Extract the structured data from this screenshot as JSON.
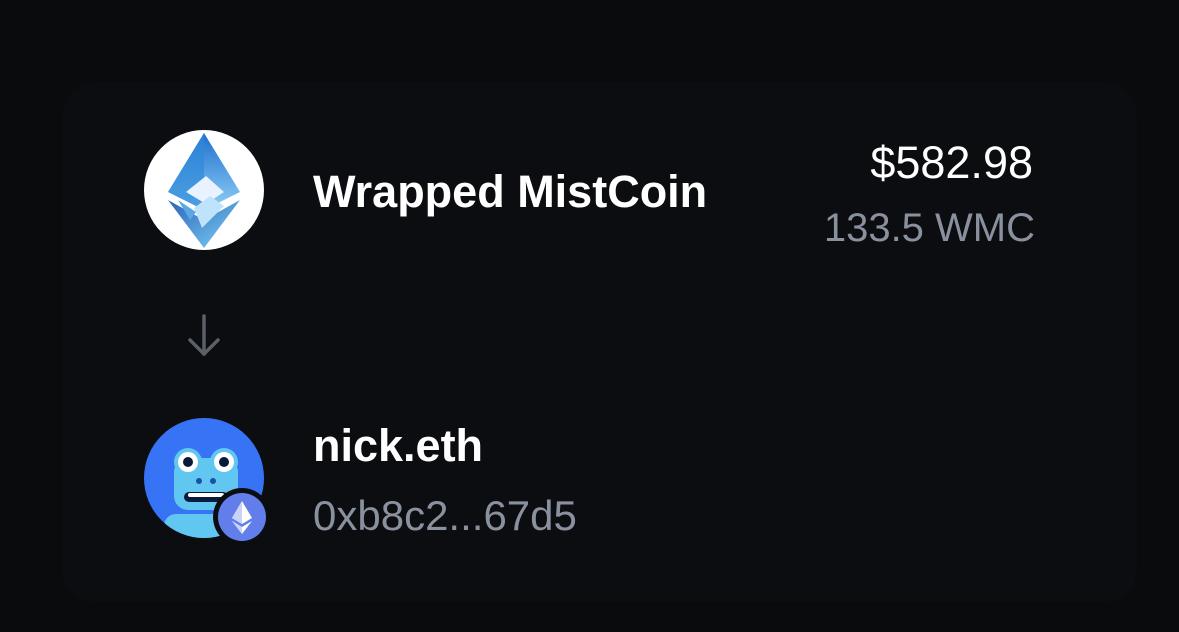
{
  "transfer": {
    "token": {
      "name": "Wrapped MistCoin",
      "fiat_amount": "$582.98",
      "amount": "133.5 WMC",
      "icon": "wrapped-mistcoin-logo-icon"
    },
    "direction_icon": "arrow-down-icon",
    "recipient": {
      "name": "nick.eth",
      "address": "0xb8c2...67d5",
      "avatar_icon": "frog-avatar-icon",
      "chain_icon": "ethereum-icon"
    }
  },
  "colors": {
    "background": "#0a0b0d",
    "card": "#0c0d10",
    "primary_text": "#ffffff",
    "secondary_text": "#8a919e",
    "avatar_blue": "#3773f5",
    "ethereum_badge": "#627eea"
  }
}
